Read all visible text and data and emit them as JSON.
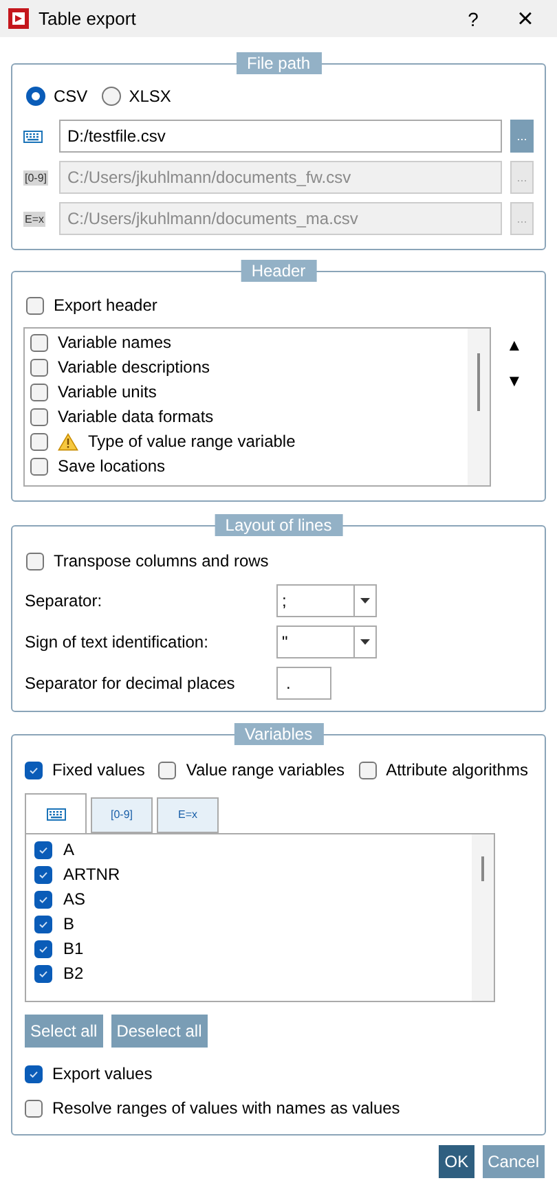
{
  "window": {
    "title": "Table export",
    "help": "?",
    "close": "×"
  },
  "file_path": {
    "legend": "File path",
    "formats": [
      {
        "label": "CSV",
        "selected": true
      },
      {
        "label": "XLSX",
        "selected": false
      }
    ],
    "paths": [
      {
        "kind": "keyboard",
        "value": "D:/testfile.csv",
        "disabled": false,
        "browse": "..."
      },
      {
        "kind": "tag",
        "tag": "[0-9]",
        "value": "C:/Users/jkuhlmann/documents_fw.csv",
        "disabled": true,
        "browse": "..."
      },
      {
        "kind": "tag",
        "tag": "E=x",
        "value": "C:/Users/jkuhlmann/documents_ma.csv",
        "disabled": true,
        "browse": "..."
      }
    ]
  },
  "header": {
    "legend": "Header",
    "export_header": {
      "label": "Export header",
      "checked": false
    },
    "items": [
      {
        "label": "Variable names",
        "checked": false,
        "warning": false
      },
      {
        "label": "Variable descriptions",
        "checked": false,
        "warning": false
      },
      {
        "label": "Variable units",
        "checked": false,
        "warning": false
      },
      {
        "label": "Variable data formats",
        "checked": false,
        "warning": false
      },
      {
        "label": "Type of value range variable",
        "checked": false,
        "warning": true
      },
      {
        "label": "Save locations",
        "checked": false,
        "warning": false
      }
    ],
    "move_up": "▲",
    "move_down": "▼"
  },
  "layout_of_lines": {
    "legend": "Layout of lines",
    "transpose": {
      "label": "Transpose columns and rows",
      "checked": false
    },
    "fields": [
      {
        "kind": "dropdown",
        "label": "Separator:",
        "value": ";"
      },
      {
        "kind": "dropdown",
        "label": "Sign of text identification:",
        "value": "\""
      },
      {
        "kind": "input",
        "label": "Separator for decimal places",
        "value": "."
      }
    ]
  },
  "variables": {
    "legend": "Variables",
    "filters": [
      {
        "label": "Fixed values",
        "checked": true
      },
      {
        "label": "Value range variables",
        "checked": false
      },
      {
        "label": "Attribute algorithms",
        "checked": false
      }
    ],
    "tabs": [
      {
        "kind": "keyboard",
        "selected": true
      },
      {
        "kind": "tag",
        "tag": "[0-9]",
        "selected": false
      },
      {
        "kind": "tag",
        "tag": "E=x",
        "selected": false
      }
    ],
    "items": [
      {
        "label": "A",
        "checked": true
      },
      {
        "label": "ARTNR",
        "checked": true
      },
      {
        "label": "AS",
        "checked": true
      },
      {
        "label": "B",
        "checked": true
      },
      {
        "label": "B1",
        "checked": true
      },
      {
        "label": "B2",
        "checked": true
      }
    ],
    "buttons": [
      "Select all",
      "Deselect all"
    ],
    "options": [
      {
        "label": "Export values",
        "checked": true
      },
      {
        "label": "Resolve ranges of values with names as values",
        "checked": false
      }
    ]
  },
  "buttons": [
    {
      "label": "OK",
      "primary": true
    },
    {
      "label": "Cancel",
      "primary": false
    }
  ]
}
